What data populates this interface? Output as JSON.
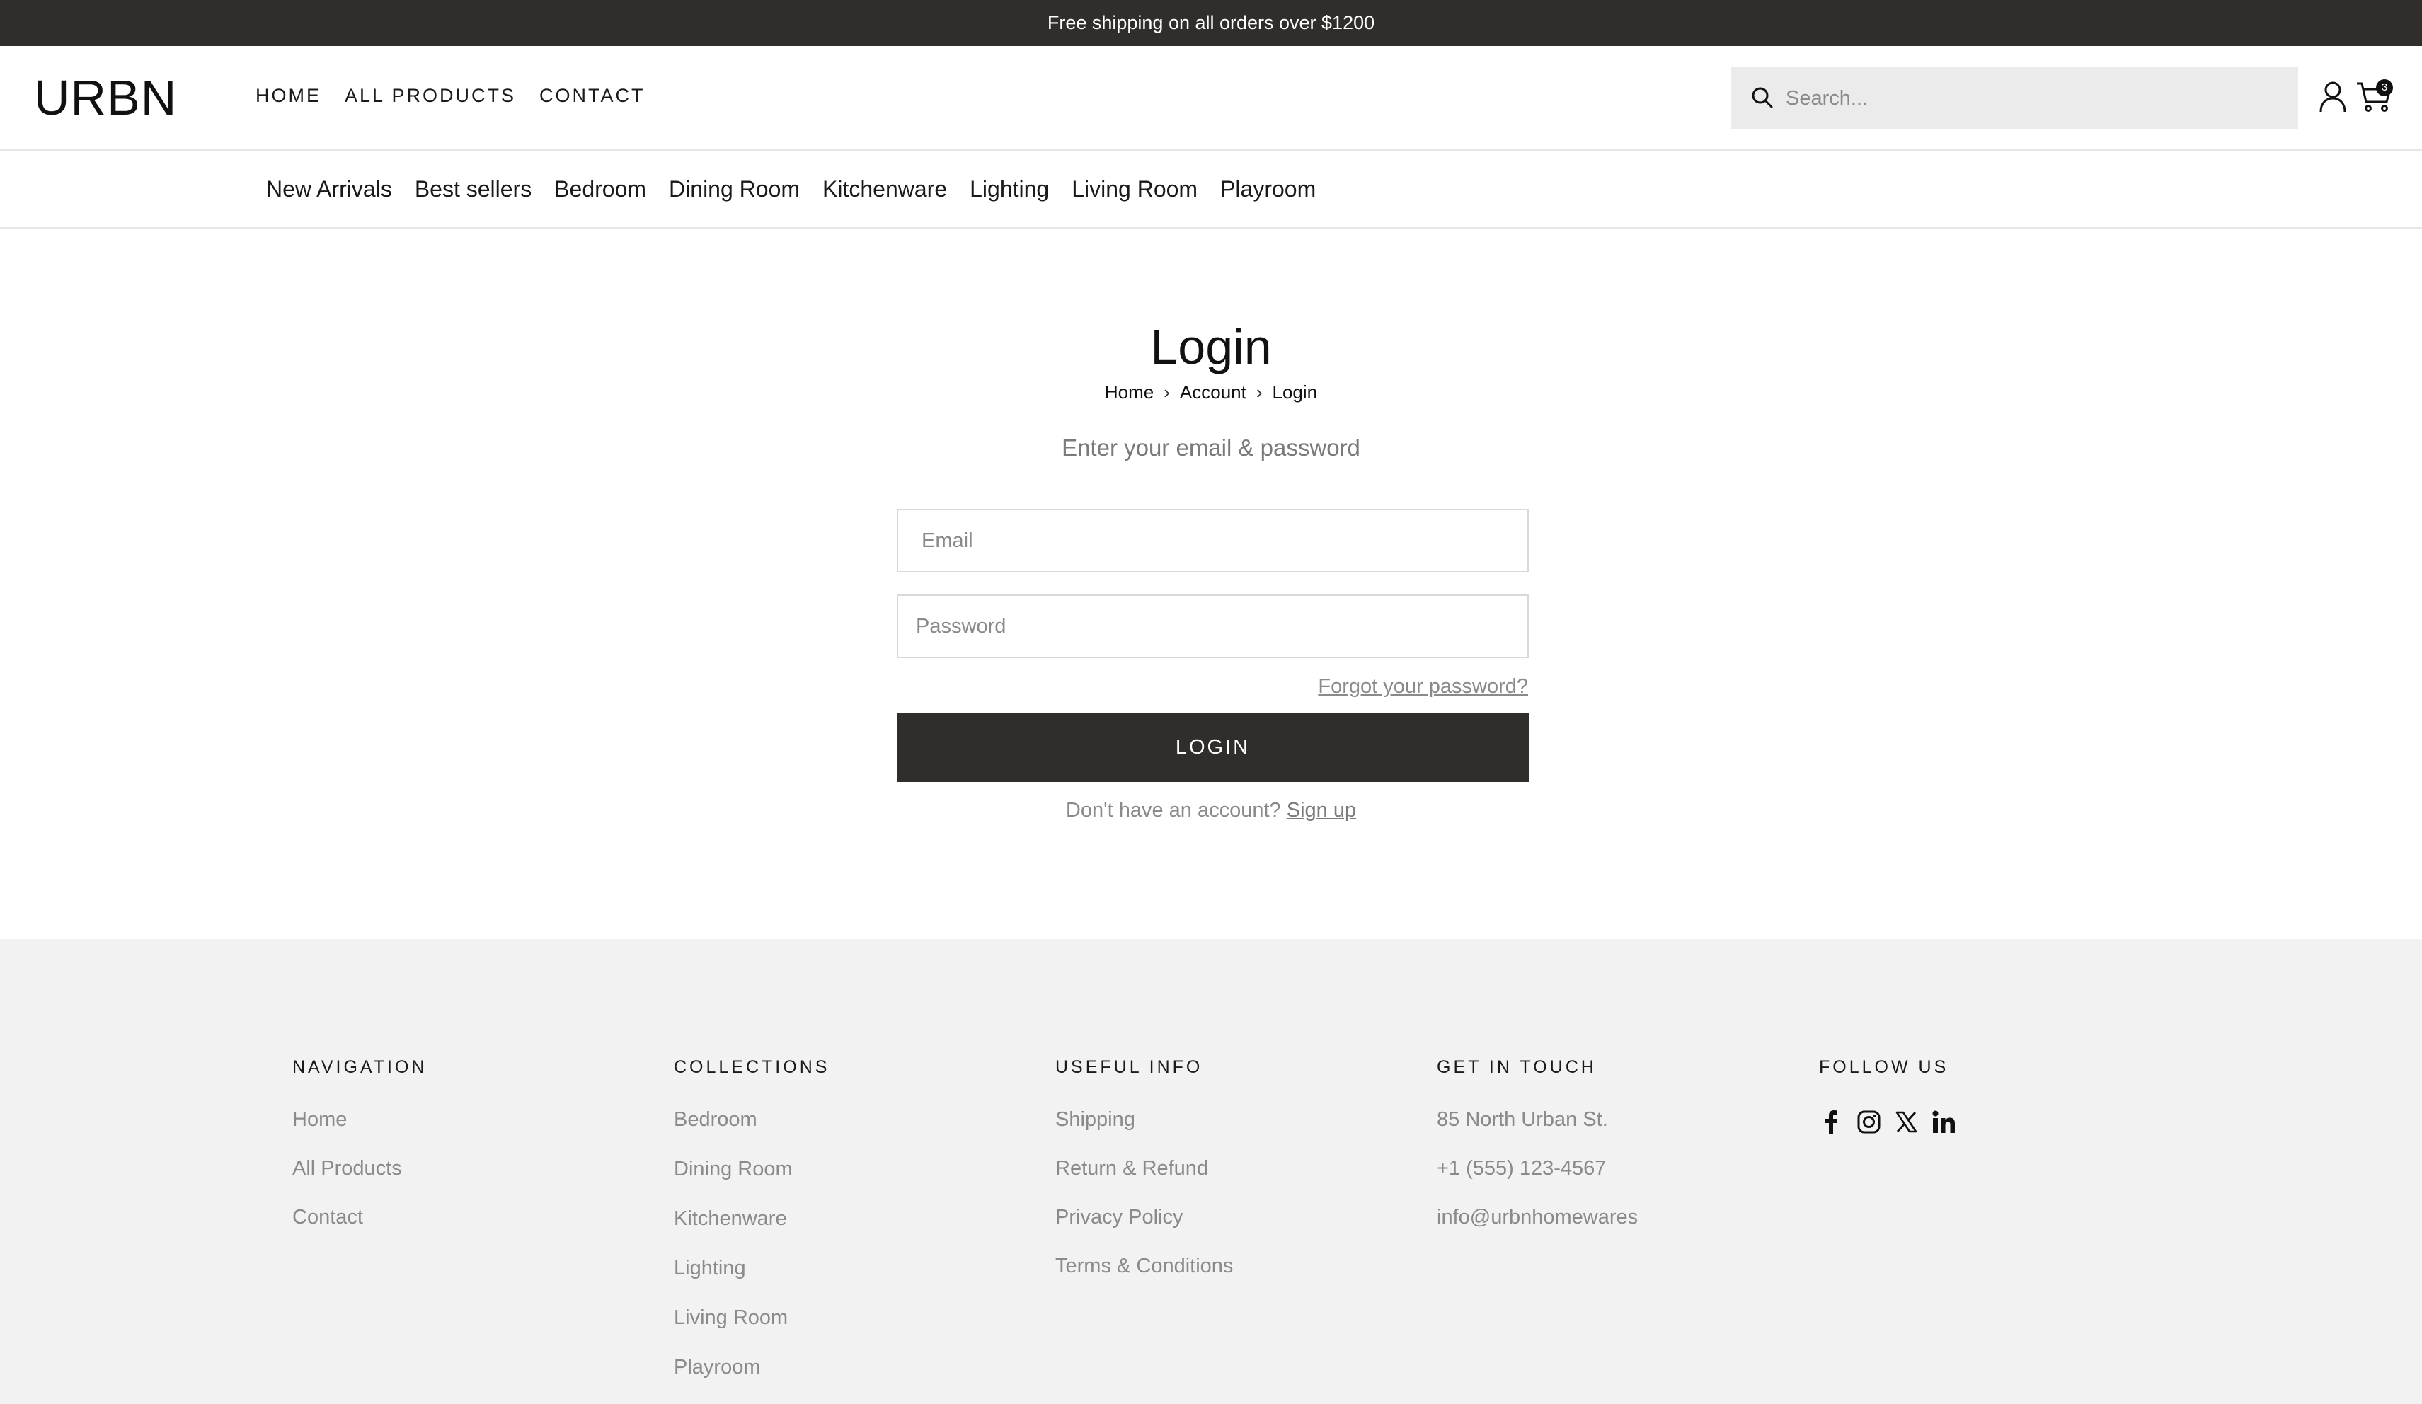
{
  "announcement": "Free shipping on all orders over $1200",
  "header": {
    "logo": "URBN",
    "nav": [
      "HOME",
      "ALL PRODUCTS",
      "CONTACT"
    ],
    "search_placeholder": "Search...",
    "cart_count": "3"
  },
  "categories": [
    "New Arrivals",
    "Best sellers",
    "Bedroom",
    "Dining Room",
    "Kitchenware",
    "Lighting",
    "Living Room",
    "Playroom"
  ],
  "login": {
    "title": "Login",
    "breadcrumb": [
      "Home",
      "Account",
      "Login"
    ],
    "subtitle": "Enter your email & password",
    "email_placeholder": "Email",
    "password_placeholder": "Password",
    "forgot": "Forgot your password?",
    "button": "LOGIN",
    "signup_prompt": "Don't have an account?",
    "signup_link": "Sign up"
  },
  "footer": {
    "navigation": {
      "title": "NAVIGATION",
      "items": [
        "Home",
        "All Products",
        "Contact"
      ]
    },
    "collections": {
      "title": "COLLECTIONS",
      "items": [
        "Bedroom",
        "Dining Room",
        "Kitchenware",
        "Lighting",
        "Living Room",
        "Playroom"
      ]
    },
    "useful_info": {
      "title": "USEFUL INFO",
      "items": [
        "Shipping",
        "Return & Refund",
        "Privacy Policy",
        "Terms & Conditions"
      ]
    },
    "get_in_touch": {
      "title": "GET IN TOUCH",
      "items": [
        "85 North Urban St.",
        "+1 (555) 123-4567",
        "info@urbnhomewares"
      ]
    },
    "follow_us": {
      "title": "FOLLOW US",
      "icons": [
        "facebook-icon",
        "instagram-icon",
        "x-icon",
        "linkedin-icon"
      ]
    }
  },
  "colors": {
    "dark": "#302d2b",
    "muted_text": "#8a8a8a",
    "footer_bg": "#f2f2f2",
    "search_bg": "#ebebeb"
  }
}
